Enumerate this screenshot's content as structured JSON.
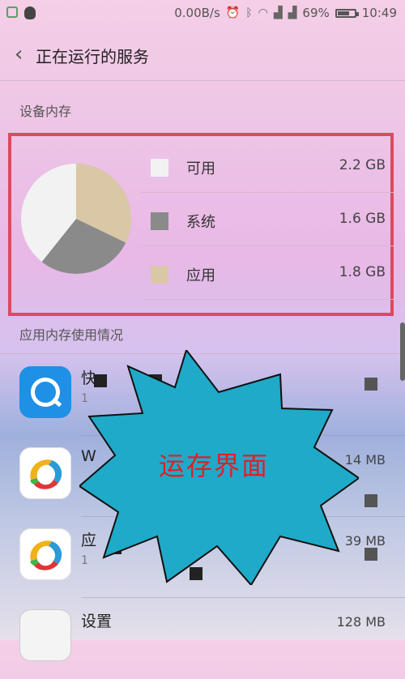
{
  "status_bar": {
    "network_speed": "0.00B/s",
    "battery_percent": "69%",
    "battery_level": 0.69,
    "time": "10:49",
    "icons": [
      "notification-icon",
      "qq-icon",
      "alarm-icon",
      "bluetooth-icon",
      "wifi-icon",
      "signal-icon",
      "signal-icon",
      "battery-icon"
    ]
  },
  "header": {
    "title": "正在运行的服务"
  },
  "memory": {
    "section_title": "设备内存",
    "items": [
      {
        "label": "可用",
        "value": "2.2 GB",
        "color": "#f2f2f2"
      },
      {
        "label": "系统",
        "value": "1.6 GB",
        "color": "#8a8a8a"
      },
      {
        "label": "应用",
        "value": "1.8 GB",
        "color": "#d9c7a6"
      }
    ]
  },
  "apps": {
    "section_title": "应用内存使用情况",
    "rows": [
      {
        "name": "快",
        "sub": "1",
        "size": "",
        "icon": "image-search-app-icon"
      },
      {
        "name": "W",
        "sub": "",
        "size": "14 MB",
        "icon": "colorful-s-app-icon"
      },
      {
        "name": "应",
        "sub": "1",
        "size": "39 MB",
        "icon": "colorful-s-app-icon"
      },
      {
        "name": "设置",
        "sub": "",
        "size": "128 MB",
        "icon": "settings-app-icon"
      }
    ]
  },
  "overlay": {
    "burst_text": "运存界面",
    "burst_color": "#1faac9",
    "text_color": "#e01f2a"
  }
}
